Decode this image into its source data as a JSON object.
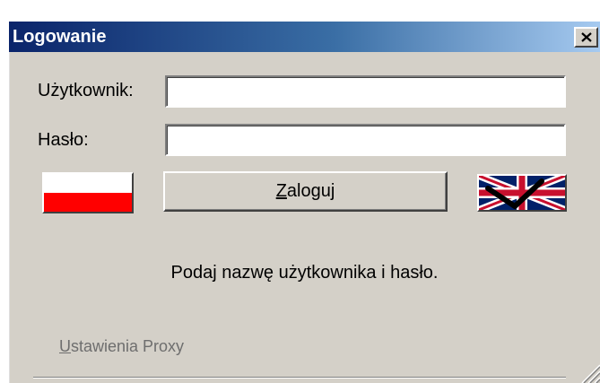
{
  "window": {
    "title": "Logowanie",
    "close_glyph": "X"
  },
  "form": {
    "username_label": "Użytkownik:",
    "username_value": "",
    "password_label": "Hasło:",
    "password_value": "",
    "login_label": "Zaloguj",
    "login_accesskey": "Z"
  },
  "languages": {
    "polish_flag_icon": "poland-flag-icon",
    "english_flag_icon": "uk-flag-icon",
    "selected_mark_icon": "checkmark-icon"
  },
  "status": {
    "message": "Podaj nazwę użytkownika i hasło."
  },
  "footer": {
    "proxy_label": "Ustawienia Proxy",
    "proxy_accesskey": "U"
  },
  "colors": {
    "titlebar_start": "#0a246a",
    "titlebar_end": "#a6caf0",
    "dialog_bg": "#d4d0c8",
    "flag_red": "#ff0000",
    "uk_blue": "#012169",
    "uk_red": "#c8102e"
  }
}
